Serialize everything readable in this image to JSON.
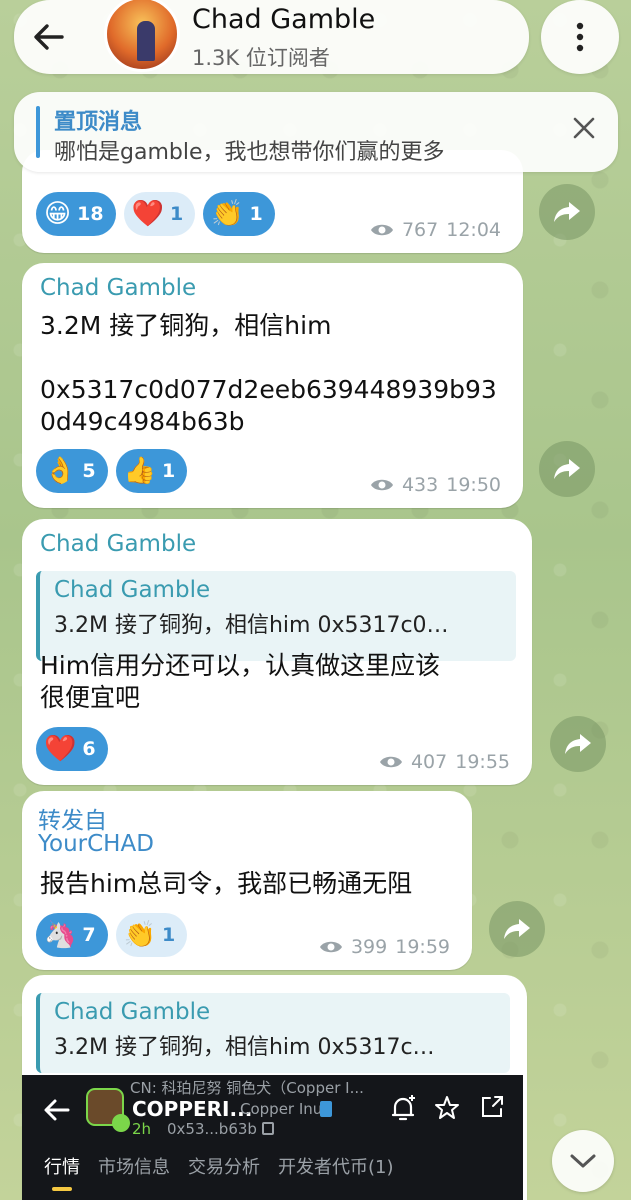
{
  "header": {
    "channel_name": "Chad Gamble",
    "subscribers": "1.3K 位订阅者"
  },
  "pinned": {
    "title": "置顶消息",
    "text": "哪怕是gamble，我也想带你们赢的更多"
  },
  "messages": [
    {
      "reactions": [
        {
          "emoji": "😁",
          "count": "18",
          "active": true
        },
        {
          "emoji": "❤️",
          "count": "1",
          "active": false
        },
        {
          "emoji": "👏",
          "count": "1",
          "active": true
        }
      ],
      "views": "767",
      "time": "12:04"
    },
    {
      "sender": "Chad Gamble",
      "text_line1": "3.2M 接了铜狗，相信him",
      "text_line2": "0x5317c0d077d2eeb639448939b93",
      "text_line3": "0d49c4984b63b",
      "reactions": [
        {
          "emoji": "👌",
          "count": "5",
          "active": true
        },
        {
          "emoji": "👍",
          "count": "1",
          "active": true
        }
      ],
      "views": "433",
      "time": "19:50"
    },
    {
      "sender": "Chad Gamble",
      "quote_sender": "Chad Gamble",
      "quote_text": "3.2M 接了铜狗，相信him  0x5317c0…",
      "text_line1": "Him信用分还可以，认真做这里应该",
      "text_line2": "很便宜吧",
      "reactions": [
        {
          "emoji": "❤️",
          "count": "6",
          "active": true
        }
      ],
      "views": "407",
      "time": "19:55"
    },
    {
      "forward_label": "转发自",
      "forward_from": "YourCHAD",
      "text": "报告him总司令，我部已畅通无阻",
      "reactions": [
        {
          "emoji": "🦄",
          "count": "7",
          "active": true
        },
        {
          "emoji": "👏",
          "count": "1",
          "active": false
        }
      ],
      "views": "399",
      "time": "19:59"
    },
    {
      "quote_sender": "Chad Gamble",
      "quote_text": "3.2M 接了铜狗，相信him  0x5317c…"
    }
  ],
  "embedded_app": {
    "cn_label": "CN: 科珀尼努 铜色犬（Copper I...",
    "token_symbol": "COPPERI...",
    "token_name": "Copper Inu",
    "age": "2h",
    "address": "0x53...b63b",
    "tabs": [
      "行情",
      "市场信息",
      "交易分析",
      "开发者代币(1)"
    ]
  },
  "colors": {
    "accent": "#3a9bb0",
    "reaction_active": "#3d97d9"
  }
}
